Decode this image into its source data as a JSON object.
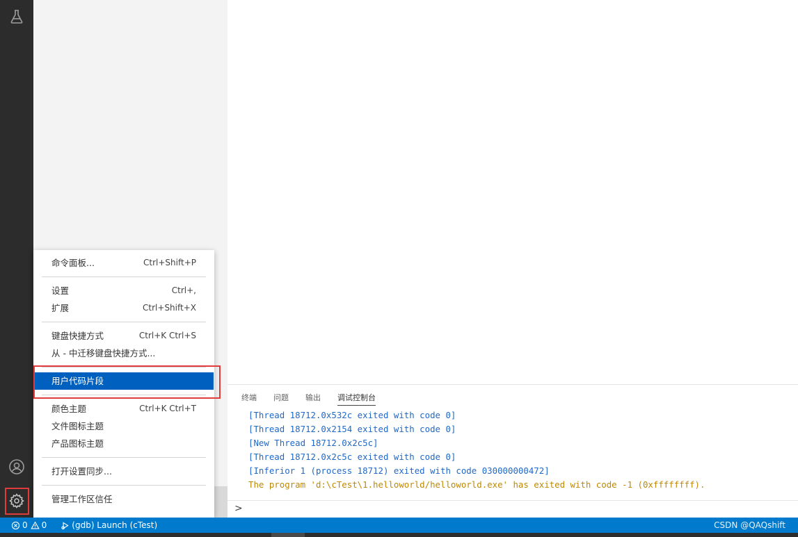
{
  "menu": {
    "groups": [
      [
        {
          "label": "命令面板...",
          "shortcut": "Ctrl+Shift+P"
        }
      ],
      [
        {
          "label": "设置",
          "shortcut": "Ctrl+,"
        },
        {
          "label": "扩展",
          "shortcut": "Ctrl+Shift+X"
        }
      ],
      [
        {
          "label": "键盘快捷方式",
          "shortcut": "Ctrl+K Ctrl+S"
        },
        {
          "label": "从 - 中迁移键盘快捷方式...",
          "shortcut": ""
        }
      ],
      [
        {
          "label": "用户代码片段",
          "shortcut": "",
          "selected": true
        }
      ],
      [
        {
          "label": "颜色主题",
          "shortcut": "Ctrl+K Ctrl+T"
        },
        {
          "label": "文件图标主题",
          "shortcut": ""
        },
        {
          "label": "产品图标主题",
          "shortcut": ""
        }
      ],
      [
        {
          "label": "打开设置同步...",
          "shortcut": ""
        }
      ],
      [
        {
          "label": "管理工作区信任",
          "shortcut": ""
        }
      ]
    ]
  },
  "panel": {
    "tabs": [
      {
        "label": "终端",
        "active": false
      },
      {
        "label": "问题",
        "active": false
      },
      {
        "label": "输出",
        "active": false
      },
      {
        "label": "调试控制台",
        "active": true
      }
    ],
    "console_lines": [
      {
        "text": "[Thread 18712.0x532c exited with code 0]",
        "kind": "info"
      },
      {
        "text": "[Thread 18712.0x2154 exited with code 0]",
        "kind": "info"
      },
      {
        "text": "[New Thread 18712.0x2c5c]",
        "kind": "info"
      },
      {
        "text": "[Thread 18712.0x2c5c exited with code 0]",
        "kind": "info"
      },
      {
        "text": "[Inferior 1 (process 18712) exited with code 030000000472]",
        "kind": "info"
      },
      {
        "text": "The program 'd:\\cTest\\1.helloworld/helloworld.exe' has exited with code -1 (0xffffffff).",
        "kind": "warn"
      }
    ],
    "prompt": ">"
  },
  "statusbar": {
    "errors": "0",
    "warnings": "0",
    "debug_label": "(gdb) Launch (cTest)",
    "watermark": "CSDN @QAQshift",
    "background": "#007acc"
  },
  "icons": {
    "activity_top": "beaker-icon",
    "account": "account-icon",
    "manage": "gear-icon"
  },
  "colors": {
    "selection": "#0060c0",
    "highlight_box": "#e03c3c",
    "console_info": "#1f68c8",
    "console_warn": "#bf8803"
  }
}
